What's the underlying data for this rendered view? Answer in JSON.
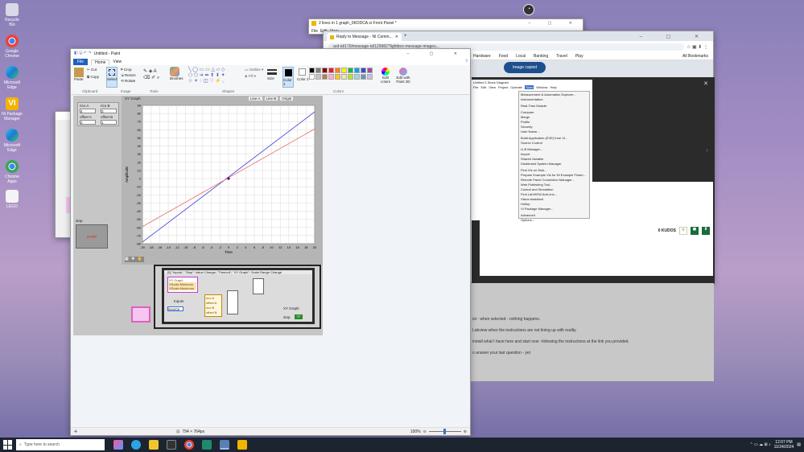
{
  "desktop": {
    "icons": [
      "Recycle Bin",
      "Google Chrome",
      "Microsoft Edge",
      "NI Package Manager",
      "Microsoft Edge",
      "Chrome Apps",
      "LEGO"
    ]
  },
  "labview_front": {
    "title": "2 lines in 1 graph_6KDDCA.vi Front Panel *",
    "menu": [
      "File",
      "Edit",
      "View"
    ]
  },
  "chrome": {
    "tab1": "Reply to Message - NI Comm...",
    "tab_new": "+",
    "address": "ard-id/170/message-id/129982?lightbox-message-images...",
    "bookmarks": [
      "Hardware",
      "Food",
      "Local",
      "Banking",
      "Travel",
      "Play"
    ],
    "all_bookmarks": "All Bookmarks",
    "toast": "Image copied",
    "kudos": "0 KUDOS",
    "post_lines": [
      "ist - when selected - nothing happens.",
      "Labview when the instructions are not lining up with reality.",
      "install what I have here and start over -following the instructions at the link you provided.",
      "o answer your last question - yet"
    ]
  },
  "block_diagram": {
    "title": "Untitled 1 Block Diagram",
    "menu": [
      "File",
      "Edit",
      "View",
      "Project",
      "Operate",
      "Tools",
      "Window",
      "Help"
    ],
    "tools_menu": [
      "Measurement & Automation Explorer...",
      "Instrumentation",
      "Real-Time Module",
      "Compare",
      "Merge",
      "Profile",
      "Security",
      "User Name...",
      "Build Application (EXE) from VI...",
      "Source Control",
      "LLB Manager...",
      "Import",
      "Shared Variable",
      "Distributed System Manager",
      "Find VIs on Disk...",
      "Prepare Example VIs for NI Example Finder...",
      "Remote Panel Connection Manager...",
      "Web Publishing Tool...",
      "Control and Simulation",
      "Find LabVIEW Add-ons...",
      "Vision Assistant",
      "Holtop",
      "VI Package Manager...",
      "Advanced",
      "Options..."
    ]
  },
  "paint": {
    "title": "Untitled - Paint",
    "tabs": [
      "File",
      "Home",
      "View"
    ],
    "clipboard": {
      "paste": "Paste",
      "cut": "Cut",
      "copy": "Copy",
      "label": "Clipboard"
    },
    "image": {
      "select": "Select",
      "crop": "Crop",
      "resize": "Resize",
      "rotate": "Rotate",
      "label": "Image"
    },
    "tools_label": "Tools",
    "brushes": "Brushes",
    "shapes_label": "Shapes",
    "outline": "Outline",
    "fill": "Fill",
    "size": "Size",
    "color1": "Color 1",
    "color2": "Color 2",
    "colors_label": "Colors",
    "edit_colors": "Edit colors",
    "paint3d": "Edit with Paint 3D",
    "status": {
      "dimensions": "794 × 764px",
      "zoom": "100%"
    },
    "palette": [
      "#000000",
      "#7f7f7f",
      "#880015",
      "#ed1c24",
      "#ff7f27",
      "#fff200",
      "#22b14c",
      "#00a2e8",
      "#3f48cc",
      "#a349a4",
      "#ffffff",
      "#c3c3c3",
      "#b97a57",
      "#ffaec9",
      "#ffc90e",
      "#efe4b0",
      "#b5e61d",
      "#99d9ea",
      "#7092be",
      "#c8bfe7"
    ]
  },
  "front_panel": {
    "graph_label": "XY Graph",
    "legend": [
      "Line A",
      "Line B",
      "Origin"
    ],
    "controls": [
      {
        "label": "rico A",
        "value": "4"
      },
      {
        "label": "rico B",
        "value": "3"
      },
      {
        "label": "offset A",
        "value": "2"
      },
      {
        "label": "offset B",
        "value": "1"
      }
    ],
    "stop_label": "stop",
    "stop_button": "STOP"
  },
  "chart_data": {
    "type": "line",
    "xlabel": "Time",
    "ylabel": "Amplitude",
    "xlim": [
      -20,
      20
    ],
    "ylim": [
      -80,
      90
    ],
    "x_ticks": [
      -20,
      -18,
      -16,
      -14,
      -12,
      -10,
      -8,
      -6,
      -4,
      -2,
      0,
      2,
      4,
      6,
      8,
      10,
      12,
      14,
      16,
      18,
      20
    ],
    "y_ticks": [
      90,
      80,
      70,
      60,
      50,
      40,
      30,
      20,
      10,
      0,
      -10,
      -20,
      -30,
      -40,
      -50,
      -60,
      -70,
      -80
    ],
    "series": [
      {
        "name": "Line A",
        "color": "#3b3bd6",
        "x": [
          -20,
          20
        ],
        "y": [
          -78,
          82
        ]
      },
      {
        "name": "Line B",
        "color": "#e86a6a",
        "x": [
          -20,
          20
        ],
        "y": [
          -59,
          61
        ]
      }
    ],
    "origin": {
      "x": 0,
      "y": 0
    }
  },
  "diagram": {
    "event_case": "[0] \"Inputs\", \"Stop\": Value Change; \"Timeout\"; \"XY Graph\": Scale Range Change",
    "graph_ref": "XY Graph",
    "xscale_min": "XScale.Minimum",
    "xscale_max": "XScale.Maximum",
    "inputs": "Inputs",
    "source": "Source",
    "terms": [
      "rico A",
      "offset A",
      "rico B",
      "offset B"
    ],
    "xy_graph": "XY Graph",
    "stop": "stop",
    "tf": "TF"
  },
  "taskbar": {
    "search_placeholder": "Type here to search",
    "time": "12:07 PM",
    "date": "11/24/2024"
  }
}
